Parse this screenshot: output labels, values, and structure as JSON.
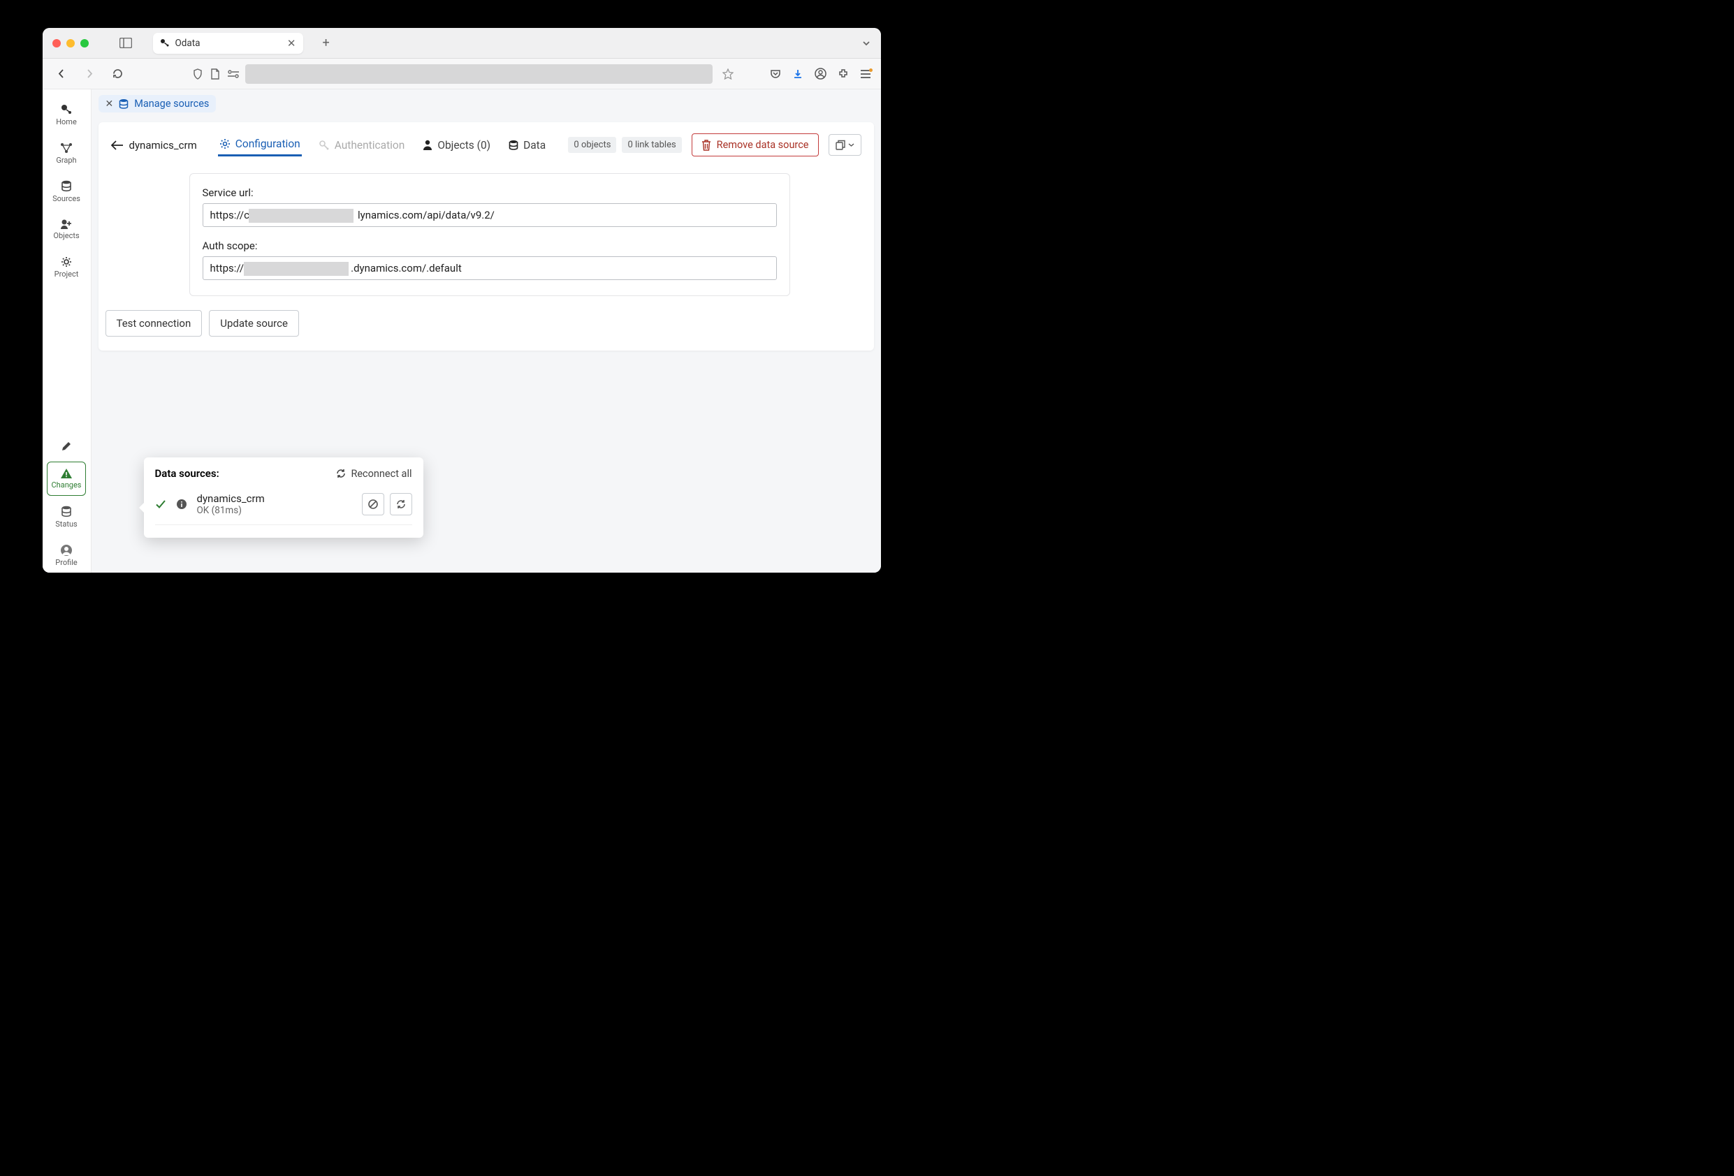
{
  "browser": {
    "tab_title": "Odata"
  },
  "sidebar": {
    "items": [
      {
        "label": "Home"
      },
      {
        "label": "Graph"
      },
      {
        "label": "Sources"
      },
      {
        "label": "Objects"
      },
      {
        "label": "Project"
      }
    ],
    "bottom": [
      {
        "label": "Changes"
      },
      {
        "label": "Status"
      },
      {
        "label": "Profile"
      }
    ]
  },
  "breadcrumb": {
    "label": "Manage sources"
  },
  "page": {
    "source_name": "dynamics_crm",
    "tabs": {
      "configuration": "Configuration",
      "authentication": "Authentication",
      "objects": "Objects (0)",
      "data": "Data"
    },
    "badges": {
      "objects": "0 objects",
      "link_tables": "0 link tables"
    },
    "remove": "Remove data source"
  },
  "form": {
    "service_url_label": "Service url:",
    "service_url_value_left": "https://c",
    "service_url_value_right": "lynamics.com/api/data/v9.2/",
    "auth_scope_label": "Auth scope:",
    "auth_scope_left": "https://",
    "auth_scope_right": ".dynamics.com/.default",
    "test_btn": "Test connection",
    "update_btn": "Update source"
  },
  "popup": {
    "title": "Data sources:",
    "reconnect": "Reconnect all",
    "ds_name": "dynamics_crm",
    "ds_status": "OK (81ms)"
  }
}
